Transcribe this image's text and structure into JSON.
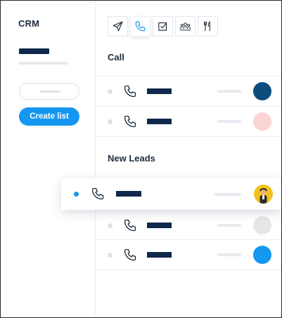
{
  "sidebar": {
    "title": "CRM",
    "create_button_label": "Create list"
  },
  "toolbar": {
    "tools": [
      {
        "icon": "send-icon",
        "active": false
      },
      {
        "icon": "phone-icon",
        "active": true
      },
      {
        "icon": "checkbox-icon",
        "active": false
      },
      {
        "icon": "group-icon",
        "active": false
      },
      {
        "icon": "fork-knife-icon",
        "active": false
      }
    ]
  },
  "sections": [
    {
      "title": "Call",
      "rows": [
        {
          "avatar_color": "#0d4d7e"
        },
        {
          "avatar_color": "#fbd5d3"
        }
      ]
    },
    {
      "title": "New Leads",
      "highlighted_row": {
        "avatar_color": "#f3c11e",
        "status_dot_color": "#1597f1"
      },
      "rows": [
        {
          "avatar_color": "#e6e6e6"
        },
        {
          "avatar_color": "#1597f1"
        }
      ]
    }
  ],
  "colors": {
    "accent": "#1597f1",
    "navy": "#10284b"
  }
}
